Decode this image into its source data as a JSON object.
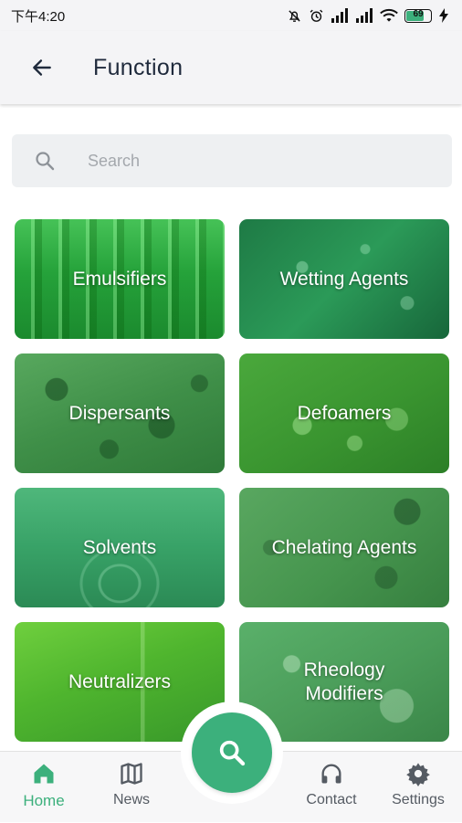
{
  "status_bar": {
    "time": "下午4:20",
    "battery": "69"
  },
  "app_bar": {
    "title": "Function",
    "back_icon": "arrow-back-icon"
  },
  "search": {
    "placeholder": "Search",
    "value": "",
    "icon": "search-icon"
  },
  "categories": [
    {
      "label": "Emulsifiers",
      "image": "green test tubes"
    },
    {
      "label": "Wetting Agents",
      "image": "water droplets on leaf"
    },
    {
      "label": "Dispersants",
      "image": "water droplets"
    },
    {
      "label": "Defoamers",
      "image": "bubbles"
    },
    {
      "label": "Solvents",
      "image": "droplet ripple"
    },
    {
      "label": "Chelating Agents",
      "image": "cells"
    },
    {
      "label": "Neutralizers",
      "image": "lab glassware"
    },
    {
      "label": "Rheology\nModifiers",
      "image": "molecules"
    }
  ],
  "bottom_nav": [
    {
      "label": "Home",
      "icon": "home-icon",
      "active": true
    },
    {
      "label": "News",
      "icon": "map-icon",
      "active": false
    },
    {
      "label": "Contact",
      "icon": "headphones-icon",
      "active": false
    },
    {
      "label": "Settings",
      "icon": "gear-icon",
      "active": false
    }
  ],
  "fab": {
    "icon": "search-icon"
  },
  "colors": {
    "accent": "#3cb07c",
    "inactive": "#555b63",
    "tile_green": "#2e9a4c"
  }
}
